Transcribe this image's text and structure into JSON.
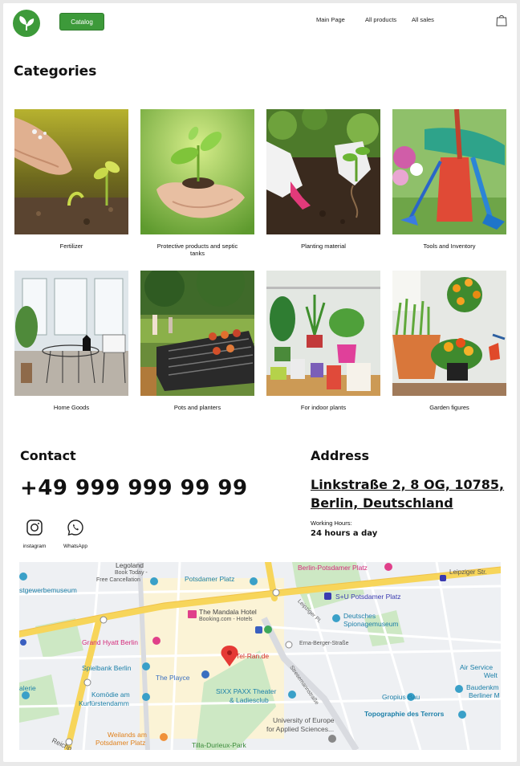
{
  "header": {
    "catalog_label": "Catalog",
    "nav": [
      "Main Page",
      "All products",
      "All sales"
    ]
  },
  "categories": {
    "title": "Categories",
    "items": [
      "Fertilizer",
      "Protective products and septic tanks",
      "Planting material",
      "Tools and Inventory",
      "Home Goods",
      "Pots and planters",
      "For indoor plants",
      "Garden figures"
    ]
  },
  "contact": {
    "title": "Contact",
    "phone": "+49 999 999 99 99",
    "instagram_label": "instagram",
    "whatsapp_label": "WhatsApp"
  },
  "address": {
    "title": "Address",
    "line1": "Linkstraße 2, 8 OG, 10785,",
    "line2": "Berlin, Deutschland",
    "working_hours_label": "Working Hours:",
    "working_hours_value": "24 hours a day"
  },
  "map": {
    "labels": [
      "Legoland",
      "Book Today -",
      "Free Cancellation",
      "Potsdamer Platz",
      "Berlin-Potsdamer Platz",
      "Leipziger Str.",
      "stgewerbemuseum",
      "S+U Potsdamer Platz",
      "The Mandala Hotel",
      "Booking.com - Hotels",
      "Deutsches",
      "Spionagemuseum",
      "Grand Hyatt Berlin",
      "Tel-Ran.de",
      "Erna-Berger-Straße",
      "Spielbank Berlin",
      "The Playce",
      "Air Service",
      "Welt",
      "SIXX PAXX Theater",
      "& Ladiesclub",
      "Gropius Bau",
      "Baudenkm",
      "Berliner M",
      "Komödie am",
      "Kurfürstendamm",
      "alerie",
      "Topographie des Terrors",
      "University of Europe",
      "for Applied Sciences...",
      "Weilands am",
      "Potsdamer Platz",
      "Tilla-Durieux-Park",
      "Reichp",
      "Leipziger Pl.",
      "Stresemannstraße"
    ]
  },
  "colors": {
    "brand_green": "#3d9a3a",
    "map_road": "#f7d55a",
    "map_park": "#c9e6c0",
    "map_marker": "#e53935"
  }
}
